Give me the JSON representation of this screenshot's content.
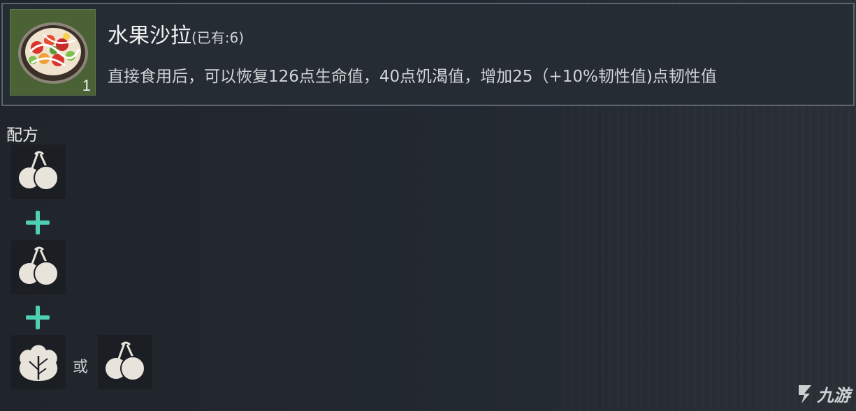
{
  "item": {
    "name": "水果沙拉",
    "owned": "(已有:6)",
    "count": "1",
    "icon": "fruit-salad-icon",
    "description": "直接食用后，可以恢复126点生命值，40点饥渴值，增加25（+10%韧性值)点韧性值",
    "slot_color": "#4a6236"
  },
  "recipe": {
    "label": "配方",
    "ingredients": [
      {
        "icon": "berries-icon"
      },
      {
        "icon": "berries-icon"
      }
    ],
    "last_options": [
      {
        "icon": "leafy-vegetable-icon"
      },
      {
        "icon": "berries-icon"
      }
    ],
    "or_label": "或",
    "plus_color": "#4fd0b5"
  },
  "watermark": {
    "text": "九游"
  }
}
